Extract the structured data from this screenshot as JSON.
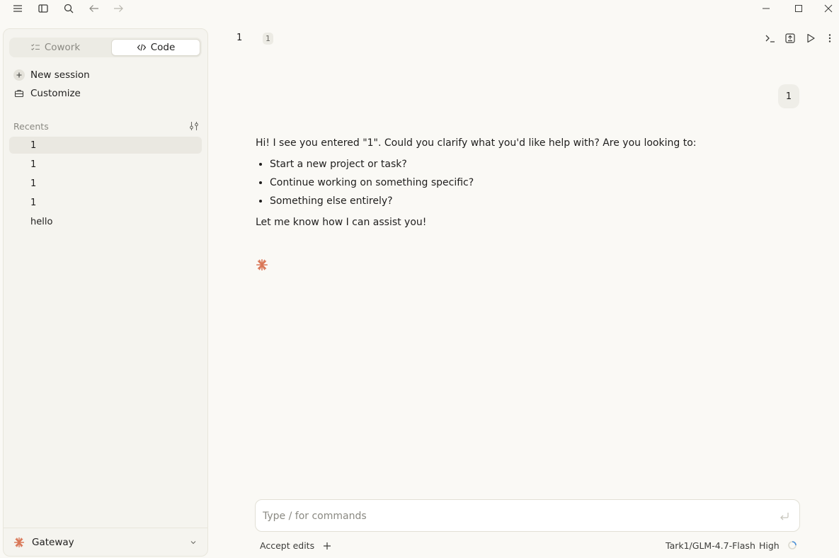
{
  "sidebar": {
    "mode_cowork": "Cowork",
    "mode_code": "Code",
    "new_session": "New session",
    "customize": "Customize",
    "recents_label": "Recents",
    "recents": [
      {
        "label": "1"
      },
      {
        "label": "1"
      },
      {
        "label": "1"
      },
      {
        "label": "1"
      },
      {
        "label": "hello"
      }
    ],
    "footer_label": "Gateway"
  },
  "header": {
    "title": "1",
    "badge": "1"
  },
  "chat": {
    "user_message": "1",
    "assistant_intro": "Hi! I see you entered \"1\". Could you clarify what you'd like help with? Are you looking to:",
    "assistant_bullets": [
      "Start a new project or task?",
      "Continue working on something specific?",
      "Something else entirely?"
    ],
    "assistant_outro": "Let me know how I can assist you!"
  },
  "composer": {
    "placeholder": "Type / for commands",
    "value": ""
  },
  "bottom_bar": {
    "accept_edits": "Accept edits",
    "model": "Tark1/GLM-4.7-Flash",
    "effort": "High"
  },
  "colors": {
    "background": "#faf9f5",
    "sidebar": "#f5f4ef",
    "accent": "#d97757"
  },
  "icons": {
    "menu": "menu-icon",
    "sidebar_toggle": "sidebar-toggle-icon",
    "search": "search-icon",
    "back": "arrow-left-icon",
    "forward": "arrow-right-icon",
    "terminal": "terminal-icon",
    "preview": "preview-icon",
    "run": "play-icon",
    "more": "more-vertical-icon",
    "spark": "spark-icon"
  }
}
